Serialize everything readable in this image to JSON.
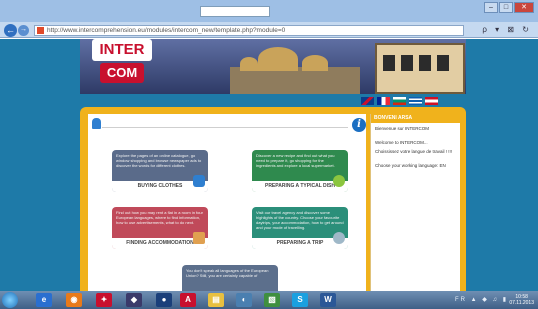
{
  "browser": {
    "title_search": "",
    "address": "http://www.intercomprehension.eu/modules/intercom_new/template.php?module=0",
    "address_host": "intercomprehension.eu",
    "window_buttons": [
      "–",
      "□",
      "✕"
    ],
    "nav_icons": "ρ ▾ ⊠ ↻"
  },
  "site": {
    "logo_top": "INTER",
    "logo_bottom": "COM",
    "flags": [
      "#0b3c8c",
      "#002395",
      "#ffffff",
      "#0d5eaf",
      "#ce1126"
    ]
  },
  "tiles": [
    {
      "description": "Explore the pages of an online catalogue, go window shopping and browse newspaper ads to discover the words for different clothes.",
      "label": "BUYING CLOTHES",
      "color": "#5a6b8a"
    },
    {
      "description": "Discover a new recipe and find out what you need to prepare it, go shopping for the ingredients and explore a local supermarket.",
      "label": "PREPARING A TYPICAL DISH",
      "color": "#2f8a4e"
    },
    {
      "description": "Find out how you may rent a flat in a room in four European languages, where to find information, how to use advertisements, what to do next.",
      "label": "FINDING ACCOMMODATION",
      "color": "#c04a5a"
    },
    {
      "description": "Visit our travel agency and discover some highlights of the country. Choose your favourite daytrips, your accommodation, how to get around and your mode of travelling.",
      "label": "PREPARING A TRIP",
      "color": "#2b8f7a"
    },
    {
      "description": "You don't speak all languages of the European Union? Still, you are certainly capable of",
      "label": "",
      "color": "#5c6f8c"
    }
  ],
  "panel": {
    "title": "BONVENI ARSA",
    "lines": [
      "Bienvenue sur INTERCOM",
      "Welcome to INTERCOM...",
      "Choississez votre langue de travail ! !!!",
      "Choose your working language: EN"
    ]
  },
  "taskbar": {
    "apps": [
      "e",
      "◉",
      "✦",
      "◆",
      "●",
      "A",
      "▤",
      "◐",
      "▧",
      "S",
      "W"
    ],
    "tray": "FR ▲ ◆ ♫ ▮",
    "time": "10:58",
    "date": "07.11.2013"
  }
}
